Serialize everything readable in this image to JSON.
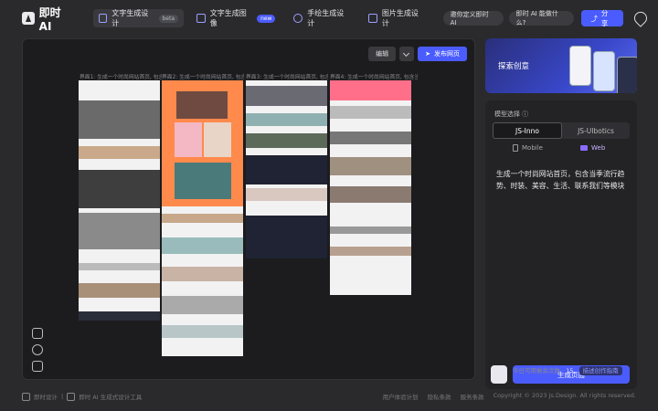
{
  "app": {
    "name": "即时AI"
  },
  "tabs": [
    {
      "label": "文字生成设计",
      "badge": "beta",
      "active": true
    },
    {
      "label": "文字生成图像",
      "badge": "new",
      "active": false
    },
    {
      "label": "手绘生成设计",
      "badge": "",
      "active": false
    },
    {
      "label": "图片生成设计",
      "badge": "",
      "active": false
    }
  ],
  "header": {
    "invite": "邀你定义即时 AI",
    "capabilities": "即时 AI 能做什么?",
    "share": "分享"
  },
  "canvas": {
    "edit": "编辑",
    "publish": "发布网页",
    "frames": [
      {
        "label": "界面1: 生成一个时尚网站首页, 包含当季流行趋势"
      },
      {
        "label": "界面2: 生成一个时尚网站首页, 包含当季流行趋势"
      },
      {
        "label": "界面3: 生成一个时尚网站首页, 包含当季流行趋势"
      },
      {
        "label": "界面4: 生成一个时尚网站首页, 包含当季流行趋势"
      }
    ]
  },
  "sidebar": {
    "banner": "探索创意",
    "model_label": "模型选择",
    "models": [
      "JS-Inno",
      "JS-UIbotics"
    ],
    "devices": [
      "Mobile",
      "Web"
    ],
    "prompt": "生成一个时尚网站首页，包含当季流行趋势、时装、美容、生活、联系我们等模块",
    "generate": "生成页面",
    "remaining_label": "今日可用剩余次数 · ",
    "remaining_count": "15",
    "guide": "描述创作指南"
  },
  "footer": {
    "left1": "即时设计",
    "left2": "即时 AI 生成式设计工具",
    "links": [
      "用户体验计划",
      "隐私条款",
      "服务条款",
      "Copyright © 2023 Js.Design. All rights reserved."
    ]
  },
  "colors": {
    "accent": "#4b5cff",
    "bg": "#2a2a2c",
    "canvas": "#1c1c1e",
    "frame2_hero": "#ff8a4c",
    "frame4_hero": "#ff6f8a"
  }
}
